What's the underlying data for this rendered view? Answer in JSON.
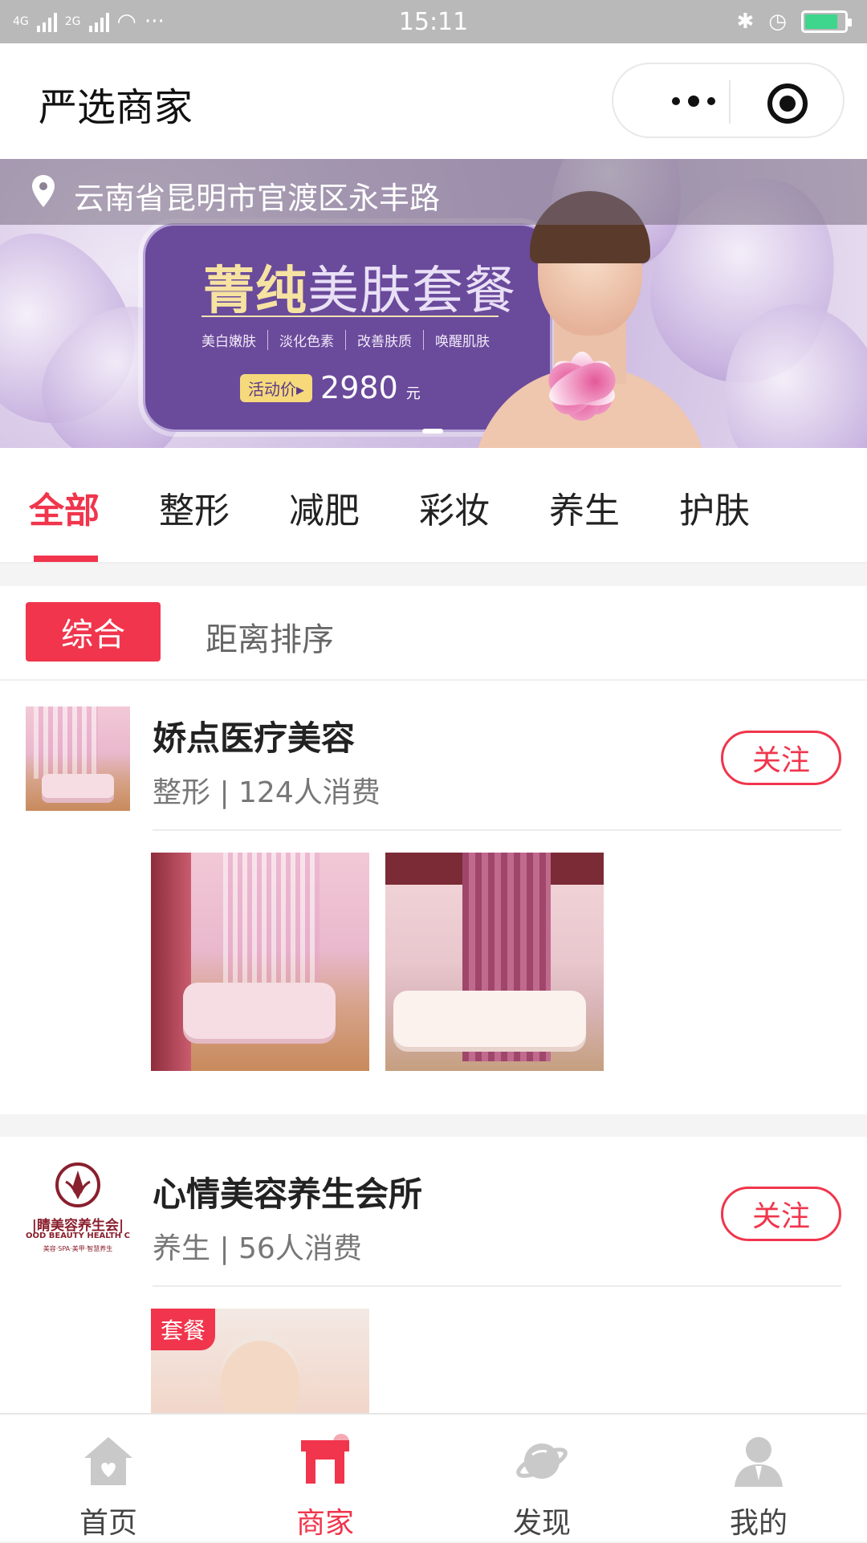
{
  "status_bar": {
    "network1": "4G",
    "network2": "2G",
    "more": "···",
    "time": "15:11"
  },
  "header": {
    "title": "严选商家"
  },
  "banner": {
    "location": "云南省昆明市官渡区永丰路",
    "title_bold": "菁纯",
    "title_rest": "美肤套餐",
    "tags": [
      "美白嫩肤",
      "淡化色素",
      "改善肤质",
      "唤醒肌肤"
    ],
    "price_label": "活动价▸",
    "price": "2980",
    "price_unit": "元"
  },
  "category_tabs": {
    "items": [
      {
        "label": "全部",
        "active": true
      },
      {
        "label": "整形",
        "active": false
      },
      {
        "label": "减肥",
        "active": false
      },
      {
        "label": "彩妆",
        "active": false
      },
      {
        "label": "养生",
        "active": false
      },
      {
        "label": "护肤",
        "active": false
      }
    ]
  },
  "sort": {
    "active": "综合",
    "distance": "距离排序"
  },
  "shops": [
    {
      "name": "娇点医疗美容",
      "meta": "整形 | 124人消费",
      "follow": "关注"
    },
    {
      "name": "心情美容养生会所",
      "meta": "养生 | 56人消费",
      "follow": "关注",
      "logo_text": "|睛美容养生会|",
      "logo_sub": "OOD BEAUTY HEALTH CL",
      "logo_tag": "美容·SPA·美甲·智慧养生",
      "photo_badge": "套餐"
    }
  ],
  "bottom_nav": {
    "items": [
      {
        "label": "首页",
        "icon": "home-icon"
      },
      {
        "label": "商家",
        "icon": "shop-icon"
      },
      {
        "label": "发现",
        "icon": "planet-icon"
      },
      {
        "label": "我的",
        "icon": "user-icon"
      }
    ]
  },
  "colors": {
    "accent": "#f0354c",
    "status_bar": "#b9b9b9",
    "banner_plaque": "#6a4a9b"
  }
}
